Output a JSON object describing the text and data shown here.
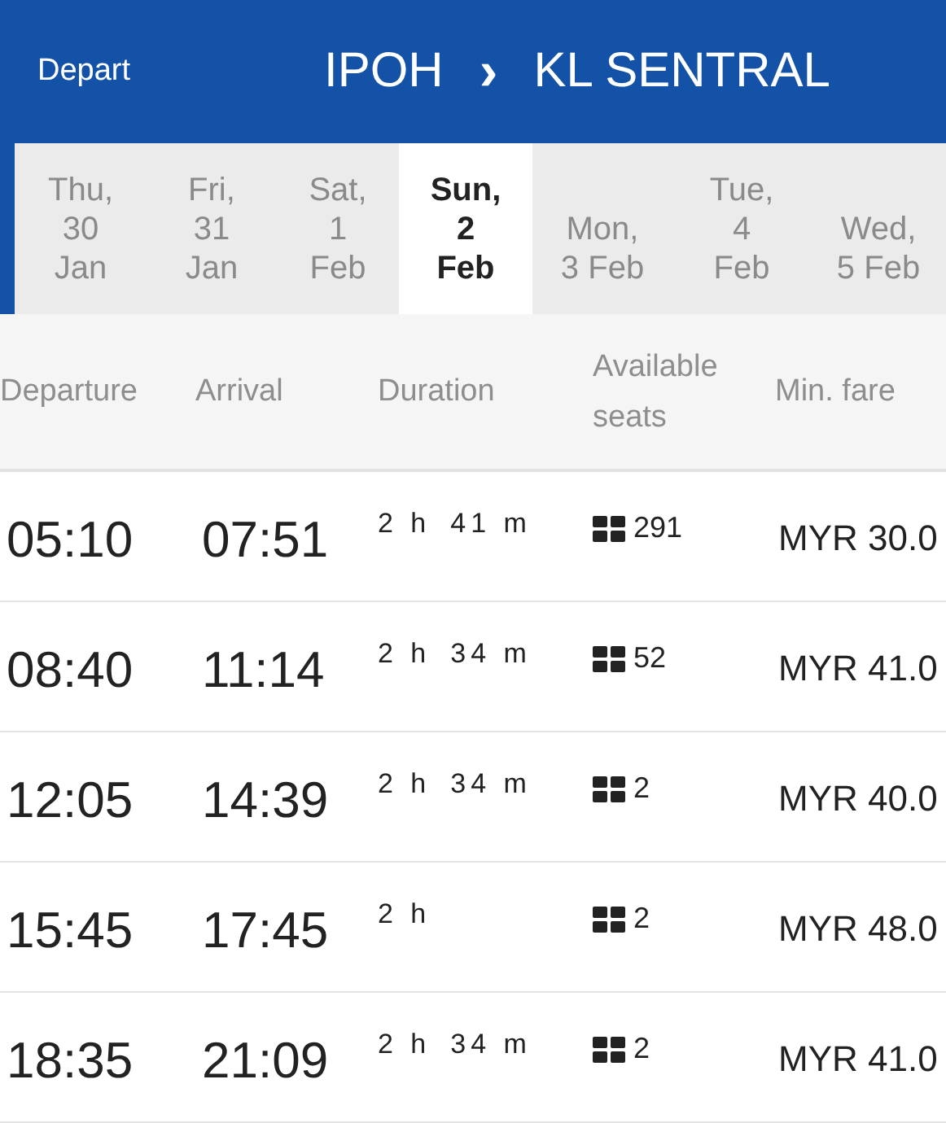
{
  "header": {
    "label": "Depart",
    "origin": "IPOH",
    "separator": "›",
    "destination": "KL SENTRAL"
  },
  "date_tabs": [
    {
      "lines": [
        "Thu,",
        "30",
        "Jan"
      ],
      "selected": false
    },
    {
      "lines": [
        "Fri,",
        "31",
        "Jan"
      ],
      "selected": false
    },
    {
      "lines": [
        "Sat,",
        "1",
        "Feb"
      ],
      "selected": false
    },
    {
      "lines": [
        "Sun,",
        "2",
        "Feb"
      ],
      "selected": true
    },
    {
      "lines": [
        "Mon,",
        "3 Feb"
      ],
      "selected": false
    },
    {
      "lines": [
        "Tue,",
        "4",
        "Feb"
      ],
      "selected": false
    },
    {
      "lines": [
        "Wed,",
        "5 Feb"
      ],
      "selected": false
    }
  ],
  "table": {
    "columns": [
      [
        "Departure"
      ],
      [
        "Arrival"
      ],
      [
        "Duration"
      ],
      [
        "Available",
        "seats"
      ],
      [
        "Min. fare"
      ]
    ],
    "rows": [
      {
        "departure": "05:10",
        "arrival": "07:51",
        "hours": "2 h",
        "minutes": "41 m",
        "seats": "291",
        "fare": "MYR 30.0"
      },
      {
        "departure": "08:40",
        "arrival": "11:14",
        "hours": "2 h",
        "minutes": "34 m",
        "seats": "52",
        "fare": "MYR 41.0"
      },
      {
        "departure": "12:05",
        "arrival": "14:39",
        "hours": "2 h",
        "minutes": "34 m",
        "seats": "2",
        "fare": "MYR 40.0"
      },
      {
        "departure": "15:45",
        "arrival": "17:45",
        "hours": "2 h",
        "seats": "2",
        "fare": "MYR 48.0"
      },
      {
        "departure": "18:35",
        "arrival": "21:09",
        "hours": "2 h",
        "minutes": "34 m",
        "seats": "2",
        "fare": "MYR 41.0"
      }
    ]
  }
}
